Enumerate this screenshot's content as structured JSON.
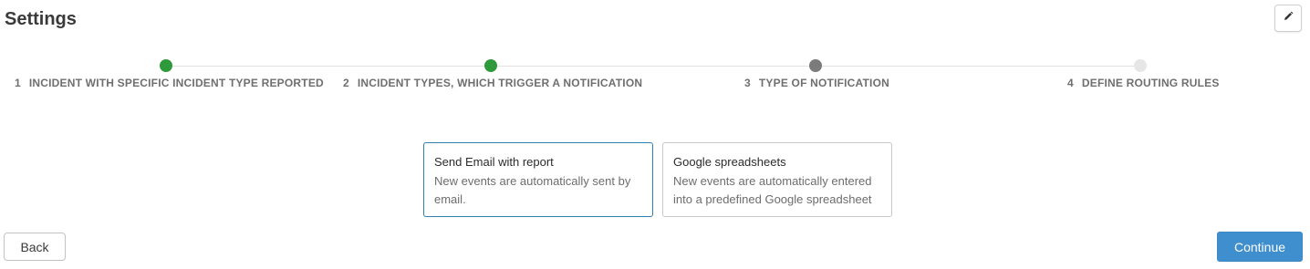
{
  "header": {
    "title": "Settings",
    "edit_icon": "pencil-icon"
  },
  "stepper": {
    "steps": [
      {
        "number": "1",
        "label": "INCIDENT WITH SPECIFIC INCIDENT TYPE REPORTED",
        "state": "done"
      },
      {
        "number": "2",
        "label": "INCIDENT TYPES, WHICH TRIGGER A NOTIFICATION",
        "state": "done"
      },
      {
        "number": "3",
        "label": "TYPE OF NOTIFICATION",
        "state": "current"
      },
      {
        "number": "4",
        "label": "DEFINE ROUTING RULES",
        "state": "pending"
      }
    ],
    "colors": {
      "done": "#2e9a3c",
      "current": "#7b7b7b",
      "pending": "#e6e6e6"
    }
  },
  "options": [
    {
      "title": "Send Email with report",
      "description": "New events are automatically sent by email.",
      "selected": true
    },
    {
      "title": "Google spreadsheets",
      "description": "New events are automatically entered into a predefined Google spreadsheet",
      "selected": false
    }
  ],
  "footer": {
    "back_label": "Back",
    "continue_label": "Continue",
    "accent": "#3f8fcf"
  }
}
